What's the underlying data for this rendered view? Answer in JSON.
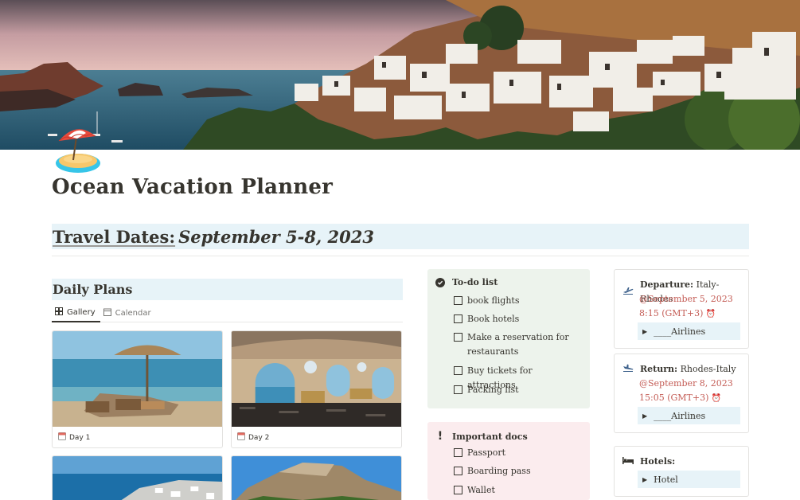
{
  "page": {
    "title": "Ocean Vacation Planner",
    "icon": "beach-umbrella-island-icon"
  },
  "travel": {
    "label": "Travel Dates:",
    "value": "September 5-8, 2023"
  },
  "daily_plans": {
    "heading": "Daily Plans",
    "views": [
      {
        "label": "Gallery",
        "icon": "gallery-grid-icon",
        "active": true
      },
      {
        "label": "Calendar",
        "icon": "calendar-icon",
        "active": false
      }
    ],
    "cards": [
      {
        "title": "Day 1",
        "icon": "calendar-page-icon"
      },
      {
        "title": "Day 2",
        "icon": "calendar-page-icon"
      }
    ]
  },
  "todo": {
    "heading": "To-do list",
    "items": [
      "book flights",
      "Book hotels",
      "Make a reservation for restaurants",
      "Buy tickets for attractions",
      "Packing list"
    ]
  },
  "docs": {
    "heading": "Important docs",
    "items": [
      "Passport",
      "Boarding pass",
      "Wallet"
    ]
  },
  "departure": {
    "label": "Departure:",
    "route": "Italy-Rhodes",
    "date": "@September 5, 2023",
    "time": "8:15 (GMT+3)",
    "toggle": "____Airlines"
  },
  "return_trip": {
    "label": "Return:",
    "route": "Rhodes-Italy",
    "date": "@September 8, 2023",
    "time": "15:05 (GMT+3)",
    "toggle": "____Airlines"
  },
  "hotels": {
    "label": "Hotels:",
    "toggle": "Hotel"
  },
  "colors": {
    "blue_highlight": "#e7f3f8",
    "green_callout": "#edf3ec",
    "red_callout": "#fbecee",
    "date_red": "#c45c55"
  }
}
